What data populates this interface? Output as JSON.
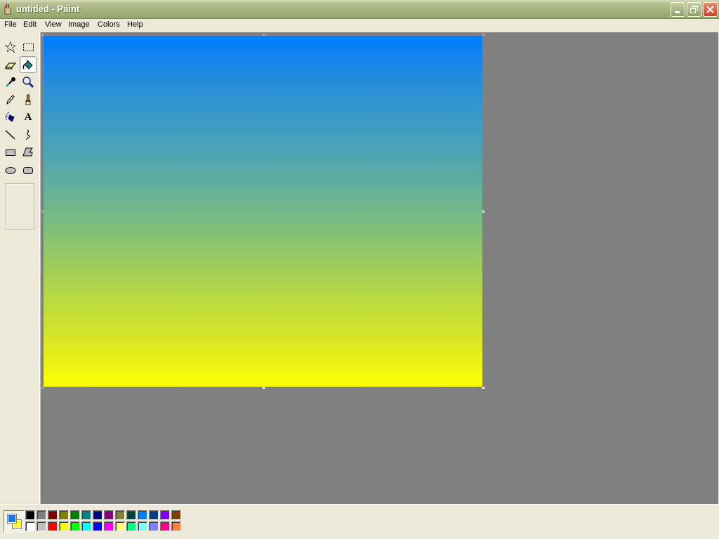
{
  "window": {
    "title": "untitled - Paint",
    "app_icon": "paint-icon",
    "controls": [
      {
        "name": "minimize-button",
        "icon": "minimize-icon"
      },
      {
        "name": "restore-button",
        "icon": "restore-icon"
      },
      {
        "name": "close-button",
        "icon": "close-icon"
      }
    ]
  },
  "menubar": {
    "items": [
      {
        "label": "File"
      },
      {
        "label": "Edit"
      },
      {
        "label": "View"
      },
      {
        "label": "Image"
      },
      {
        "label": "Colors"
      },
      {
        "label": "Help"
      }
    ]
  },
  "toolbox": {
    "selected_tool": "fill-with-color",
    "tools": [
      {
        "id": "free-form-select",
        "icon": "free-form-select-icon"
      },
      {
        "id": "select",
        "icon": "rect-select-icon"
      },
      {
        "id": "eraser",
        "icon": "eraser-icon"
      },
      {
        "id": "fill-with-color",
        "icon": "paint-bucket-icon"
      },
      {
        "id": "pick-color",
        "icon": "eyedropper-icon"
      },
      {
        "id": "magnifier",
        "icon": "magnifier-icon"
      },
      {
        "id": "pencil",
        "icon": "pencil-icon"
      },
      {
        "id": "brush",
        "icon": "brush-icon"
      },
      {
        "id": "airbrush",
        "icon": "airbrush-icon"
      },
      {
        "id": "text",
        "icon": "text-icon",
        "glyph": "A"
      },
      {
        "id": "line",
        "icon": "line-icon"
      },
      {
        "id": "curve",
        "icon": "curve-icon"
      },
      {
        "id": "rectangle",
        "icon": "rectangle-icon"
      },
      {
        "id": "polygon",
        "icon": "polygon-icon"
      },
      {
        "id": "ellipse",
        "icon": "ellipse-icon"
      },
      {
        "id": "rounded-rectangle",
        "icon": "rounded-rectangle-icon"
      }
    ]
  },
  "canvas": {
    "gradient_top_color": "#007cff",
    "gradient_bottom_color": "#ffff00"
  },
  "palette": {
    "foreground_color": "#0a7cf0",
    "background_color": "#ffff22",
    "top_row": [
      "#000000",
      "#808080",
      "#800000",
      "#808000",
      "#008000",
      "#008080",
      "#000080",
      "#800080",
      "#808040",
      "#004040",
      "#0080ff",
      "#004080",
      "#8000ff",
      "#804000"
    ],
    "bottom_row": [
      "#ffffff",
      "#c0c0c0",
      "#ff0000",
      "#ffff00",
      "#00ff00",
      "#00ffff",
      "#0000ff",
      "#ff00ff",
      "#ffff80",
      "#00ff80",
      "#80ffff",
      "#8080ff",
      "#ff0080",
      "#ff8040"
    ]
  }
}
